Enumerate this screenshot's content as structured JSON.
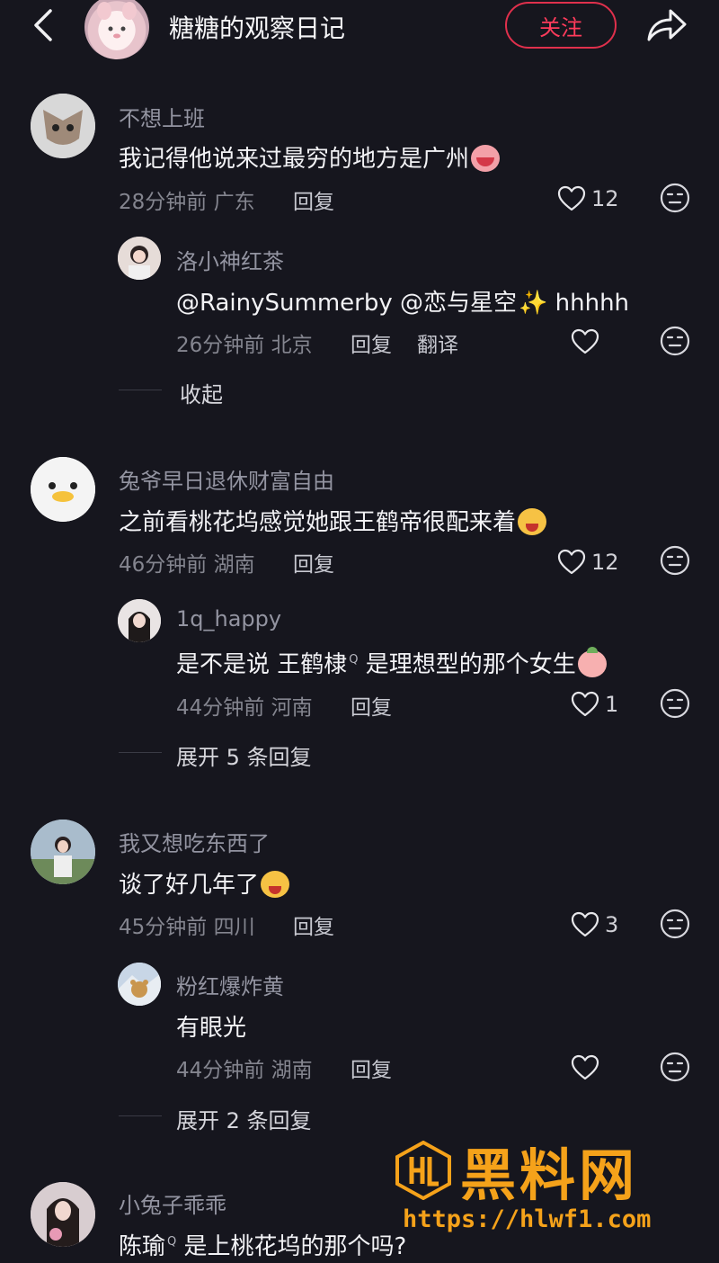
{
  "header": {
    "title": "糖糖的观察日记",
    "follow_label": "关注"
  },
  "comments": [
    {
      "name": "不想上班",
      "text": "我记得他说来过最穷的地方是广州",
      "emoji": "cry-emoji",
      "time": "28分钟前",
      "location": "广东",
      "reply_label": "回复",
      "likes": "12",
      "reply": {
        "name": "洛小神红茶",
        "text": "@RainySummerby @恋与星空",
        "text_suffix": "hhhhh",
        "time": "26分钟前",
        "location": "北京",
        "reply_label": "回复",
        "translate_label": "翻译",
        "likes": ""
      },
      "expand_label": "收起"
    },
    {
      "name": "兔爷早日退休财富自由",
      "text": "之前看桃花坞感觉她跟王鹤帝很配来着",
      "time": "46分钟前",
      "location": "湖南",
      "reply_label": "回复",
      "likes": "12",
      "reply": {
        "name": "1q_happy",
        "text_prefix": "是不是说 ",
        "text_link": "王鹤棣",
        "text_suffix": " 是理想型的那个女生",
        "time": "44分钟前",
        "location": "河南",
        "reply_label": "回复",
        "likes": "1"
      },
      "expand_label": "展开 5 条回复"
    },
    {
      "name": "我又想吃东西了",
      "text": "谈了好几年了",
      "time": "45分钟前",
      "location": "四川",
      "reply_label": "回复",
      "likes": "3",
      "reply": {
        "name": "粉红爆炸黄",
        "text": "有眼光",
        "time": "44分钟前",
        "location": "湖南",
        "reply_label": "回复",
        "likes": ""
      },
      "expand_label": "展开 2 条回复"
    },
    {
      "name": "小兔子乖乖",
      "text_link": "陈瑜",
      "text_suffix": " 是上桃花坞的那个吗?"
    }
  ],
  "watermark": {
    "title": "黑料网",
    "url": "https://hlwf1.com"
  },
  "colors": {
    "background": "#16161e",
    "follow_red": "#e0304c",
    "watermark_orange": "#f5a21a"
  }
}
